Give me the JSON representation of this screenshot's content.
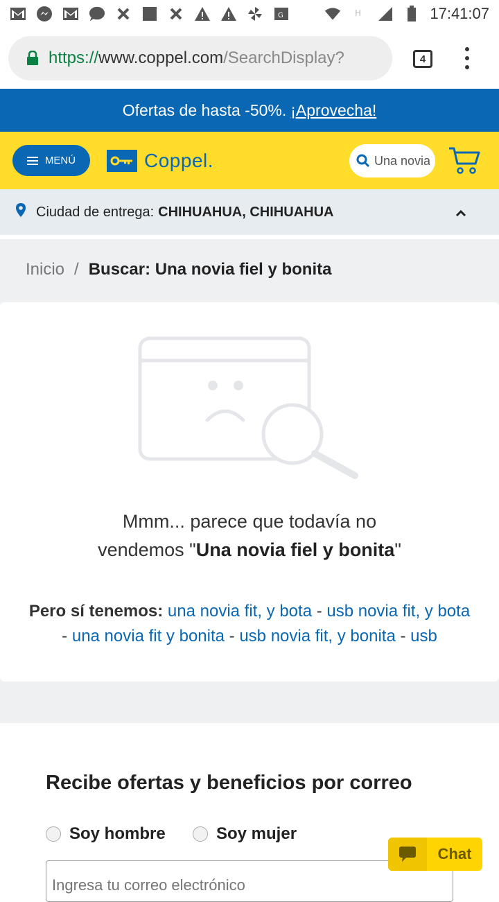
{
  "statusbar": {
    "time": "17:41:07",
    "icons": [
      "gmail-icon",
      "messenger-icon",
      "gmail-icon",
      "chat-bubble-icon",
      "x-icon",
      "square-icon",
      "x-icon",
      "warning-icon",
      "warning-icon",
      "pinwheel-icon",
      "maps-icon"
    ],
    "right_icons": [
      "wifi-icon",
      "h-signal-icon",
      "cell-signal-icon",
      "battery-icon"
    ]
  },
  "browser": {
    "url_scheme": "https://",
    "url_host": "www.coppel.com",
    "url_path": "/SearchDisplay?",
    "tab_count": "4"
  },
  "promo": {
    "text": "Ofertas de hasta -50%.",
    "link": "¡Aprovecha!"
  },
  "header": {
    "menu_label": "MENÚ",
    "logo_text": "Coppel.",
    "search_value": "Una novia fiel y bonita",
    "colors": {
      "brand_blue": "#0a67b3",
      "brand_yellow": "#ffdd2a"
    }
  },
  "delivery": {
    "label": "Ciudad de entrega:",
    "city": "CHIHUAHUA, CHIHUAHUA"
  },
  "breadcrumb": {
    "home": "Inicio",
    "separator": "/",
    "current": "Buscar: Una novia fiel y bonita"
  },
  "noresults": {
    "line1": "Mmm... parece que todavía no",
    "line2_prefix": "vendemos \"",
    "query": "Una novia fiel y bonita",
    "line2_suffix": "\"",
    "suggest_label": "Pero sí tenemos:",
    "suggestions": [
      "una novia fit, y bota",
      "usb novia fit, y bota",
      "una novia fit y bonita",
      "usb novia fit, y bonita",
      "usb"
    ],
    "separator": " - "
  },
  "newsletter": {
    "title": "Recibe ofertas y beneficios por correo",
    "option_male": "Soy hombre",
    "option_female": "Soy mujer",
    "email_placeholder": "Ingresa tu correo electrónico"
  },
  "chat": {
    "label": "Chat"
  }
}
